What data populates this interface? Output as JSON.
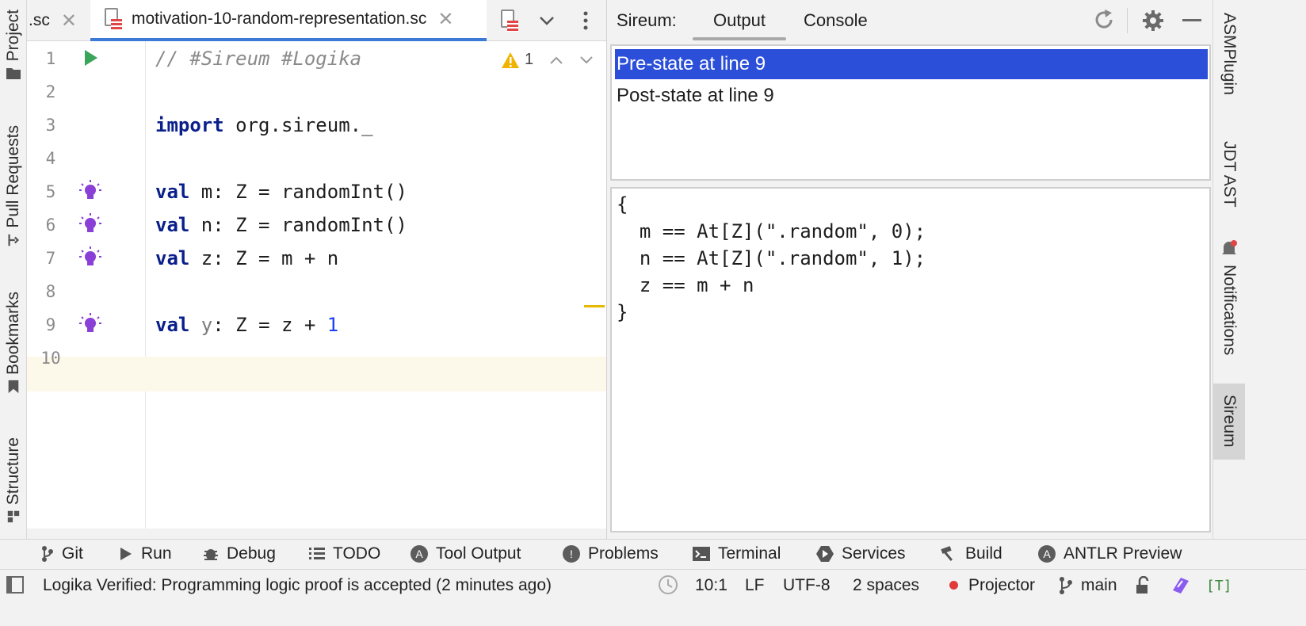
{
  "left_strip": {
    "items": [
      {
        "label": "Project",
        "icon": "folder-icon"
      },
      {
        "label": "Pull Requests",
        "icon": "pull-request-icon"
      },
      {
        "label": "Bookmarks",
        "icon": "bookmark-icon"
      },
      {
        "label": "Structure",
        "icon": "structure-icon"
      }
    ]
  },
  "editor_tabs": {
    "prev_tab_label": ".sc",
    "active_tab_label": "motivation-10-random-representation.sc"
  },
  "editor": {
    "line_numbers": [
      "1",
      "2",
      "3",
      "4",
      "5",
      "6",
      "7",
      "8",
      "9",
      "10"
    ],
    "current_line": "10",
    "warning_count": "1",
    "lines": {
      "l1_comment": "// #Sireum #Logika",
      "l3_kw": "import",
      "l3_rest": " org.sireum._",
      "l5_kw": "val",
      "l5_rest": " m: Z = randomInt()",
      "l6_kw": "val",
      "l6_rest": " n: Z = randomInt()",
      "l7_kw": "val",
      "l7_rest": " z: Z = m + n",
      "l9_kw": "val",
      "l9_name": " y",
      "l9_rest": ": Z = z + ",
      "l9_num": "1"
    }
  },
  "tool_window": {
    "title": "Sireum:",
    "tabs": [
      "Output",
      "Console"
    ],
    "active_tab": "Output",
    "states": [
      "Pre-state at line 9",
      "Post-state at line 9"
    ],
    "selected_state": "Pre-state at line 9",
    "state_content": [
      "{",
      "  m == At[Z](\".random\", 0);",
      "  n == At[Z](\".random\", 1);",
      "  z == m + n",
      "}"
    ]
  },
  "right_strip": {
    "items": [
      "ASMPlugin",
      "JDT AST",
      "Notifications",
      "Sireum"
    ],
    "active": "Sireum"
  },
  "bottom_tools": [
    "Git",
    "Run",
    "Debug",
    "TODO",
    "Tool Output",
    "Problems",
    "Terminal",
    "Services",
    "Build",
    "ANTLR Preview"
  ],
  "status_bar": {
    "message": "Logika Verified: Programming logic proof is accepted (2 minutes ago)",
    "position": "10:1",
    "line_ending": "LF",
    "encoding": "UTF-8",
    "indent": "2 spaces",
    "projector": "Projector",
    "branch": "main",
    "mode_badge": "[T]"
  },
  "colors": {
    "selection": "#2b4fd8",
    "keyword": "#0a1f8a",
    "number": "#1a3ff5",
    "accent_tab": "#3d7ad8",
    "bulb": "#8a3fd6",
    "run_arrow": "#3aa55a"
  }
}
